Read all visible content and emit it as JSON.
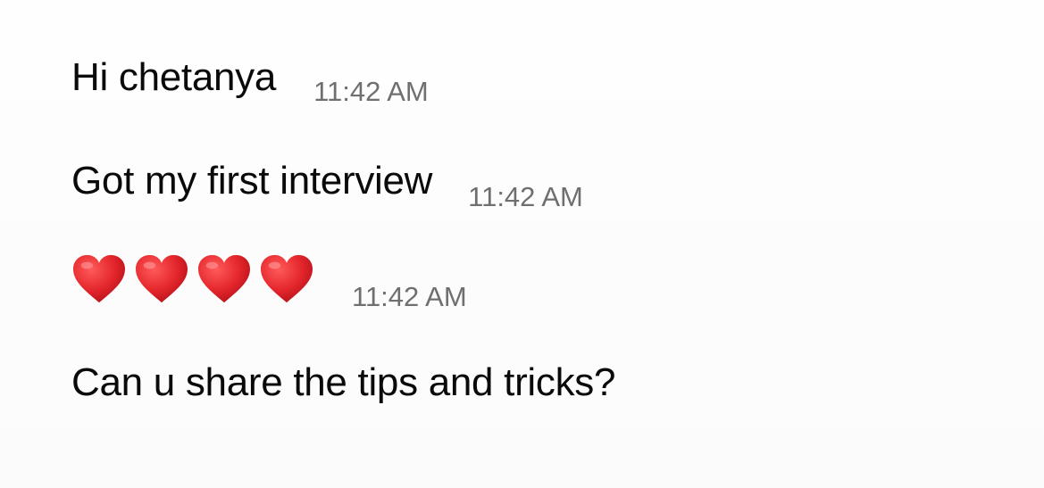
{
  "chat": {
    "messages": [
      {
        "text": "Hi chetanya",
        "time": "11:42 AM"
      },
      {
        "text": "Got my first interview",
        "time": "11:42 AM"
      },
      {
        "emoji": [
          "red-heart",
          "red-heart",
          "red-heart",
          "red-heart"
        ],
        "time": "11:42 AM"
      },
      {
        "text": "Can u share the tips and tricks?"
      }
    ]
  },
  "colors": {
    "text": "#0a0a0a",
    "timestamp": "#6f6f6f",
    "heart": "#e3262b"
  }
}
